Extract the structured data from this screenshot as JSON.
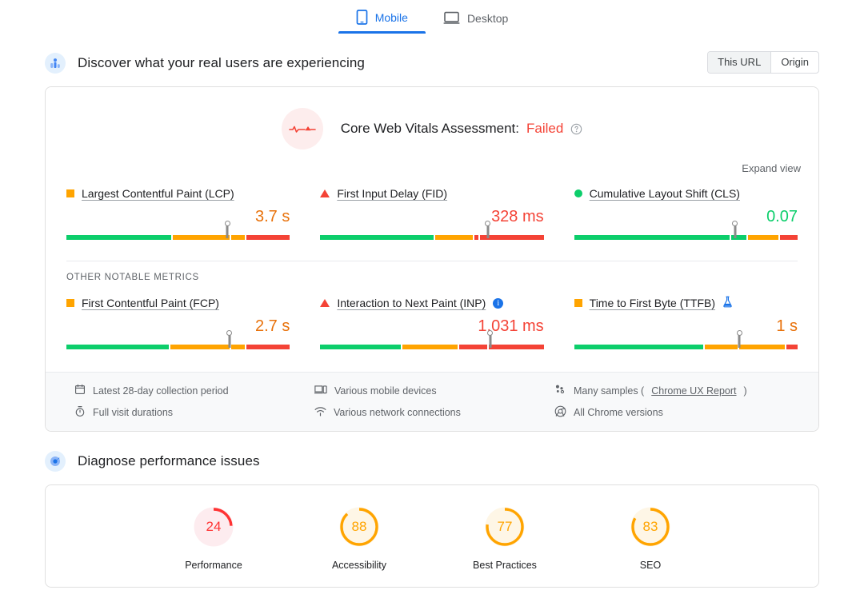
{
  "device_tabs": [
    {
      "label": "Mobile",
      "icon": "mobile-phone-icon",
      "active": true
    },
    {
      "label": "Desktop",
      "icon": "desktop-monitor-icon",
      "active": false
    }
  ],
  "field_section": {
    "icon": "real-users-icon",
    "title": "Discover what your real users are experiencing",
    "scope_toggle": {
      "this_url": "This URL",
      "origin": "Origin",
      "selected": "This URL"
    },
    "assessment": {
      "icon": "pulse-line-icon",
      "prefix": "Core Web Vitals Assessment:",
      "result": "Failed",
      "result_color": "#f44336",
      "help_icon": "help-circle-icon"
    },
    "expand_view": "Expand view",
    "other_metrics_header": "OTHER NOTABLE METRICS",
    "core_metrics": [
      {
        "name": "Largest Contentful Paint (LCP)",
        "status_icon": "orange-square",
        "value": "3.7 s",
        "value_color": "#e8710a",
        "marker_pct": 72,
        "segments": [
          {
            "color": "#0cce6b",
            "pct": 48
          },
          {
            "color": "#ffa400",
            "pct": 26
          },
          {
            "color": "#ffa400",
            "pct": 6
          },
          {
            "color": "#f44336",
            "pct": 20
          }
        ]
      },
      {
        "name": "First Input Delay (FID)",
        "status_icon": "red-triangle",
        "value": "328 ms",
        "value_color": "#f44336",
        "marker_pct": 75,
        "segments": [
          {
            "color": "#0cce6b",
            "pct": 52
          },
          {
            "color": "#ffa400",
            "pct": 17
          },
          {
            "color": "#f44336",
            "pct": 2
          },
          {
            "color": "#f44336",
            "pct": 29
          }
        ]
      },
      {
        "name": "Cumulative Layout Shift (CLS)",
        "status_icon": "green-circle",
        "value": "0.07",
        "value_color": "#0cce6b",
        "marker_pct": 72,
        "segments": [
          {
            "color": "#0cce6b",
            "pct": 71
          },
          {
            "color": "#0cce6b",
            "pct": 7
          },
          {
            "color": "#ffa400",
            "pct": 14
          },
          {
            "color": "#f44336",
            "pct": 8
          }
        ]
      }
    ],
    "other_metrics": [
      {
        "name": "First Contentful Paint (FCP)",
        "status_icon": "orange-square",
        "badge": null,
        "value": "2.7 s",
        "value_color": "#e8710a",
        "marker_pct": 73,
        "segments": [
          {
            "color": "#0cce6b",
            "pct": 47
          },
          {
            "color": "#ffa400",
            "pct": 27
          },
          {
            "color": "#ffa400",
            "pct": 6
          },
          {
            "color": "#f44336",
            "pct": 20
          }
        ]
      },
      {
        "name": "Interaction to Next Paint (INP)",
        "status_icon": "red-triangle",
        "badge": "info-icon",
        "value": "1,031 ms",
        "value_color": "#f44336",
        "marker_pct": 76,
        "segments": [
          {
            "color": "#0cce6b",
            "pct": 37
          },
          {
            "color": "#ffa400",
            "pct": 25
          },
          {
            "color": "#f44336",
            "pct": 13
          },
          {
            "color": "#f44336",
            "pct": 25
          }
        ]
      },
      {
        "name": "Time to First Byte (TTFB)",
        "status_icon": "orange-square",
        "badge": "experimental-flask-icon",
        "value": "1 s",
        "value_color": "#e8710a",
        "marker_pct": 74,
        "segments": [
          {
            "color": "#0cce6b",
            "pct": 59
          },
          {
            "color": "#ffa400",
            "pct": 15
          },
          {
            "color": "#ffa400",
            "pct": 21
          },
          {
            "color": "#f44336",
            "pct": 5
          }
        ]
      }
    ],
    "meta": [
      {
        "icon": "calendar-icon",
        "text": "Latest 28-day collection period"
      },
      {
        "icon": "devices-icon",
        "text": "Various mobile devices"
      },
      {
        "icon": "samples-icon",
        "text": "Many samples (",
        "link": "Chrome UX Report",
        "suffix": ")"
      },
      {
        "icon": "stopwatch-icon",
        "text": "Full visit durations"
      },
      {
        "icon": "network-icon",
        "text": "Various network connections"
      },
      {
        "icon": "chrome-icon",
        "text": "All Chrome versions"
      }
    ]
  },
  "diagnose_section": {
    "icon": "diagnose-icon",
    "title": "Diagnose performance issues",
    "scores": [
      {
        "label": "Performance",
        "value": 24,
        "color": "#f33",
        "track": "#fdecef"
      },
      {
        "label": "Accessibility",
        "value": 88,
        "color": "#ffa400",
        "track": "#fef6e6"
      },
      {
        "label": "Best Practices",
        "value": 77,
        "color": "#ffa400",
        "track": "#fef6e6"
      },
      {
        "label": "SEO",
        "value": 83,
        "color": "#ffa400",
        "track": "#fef6e6"
      }
    ]
  }
}
